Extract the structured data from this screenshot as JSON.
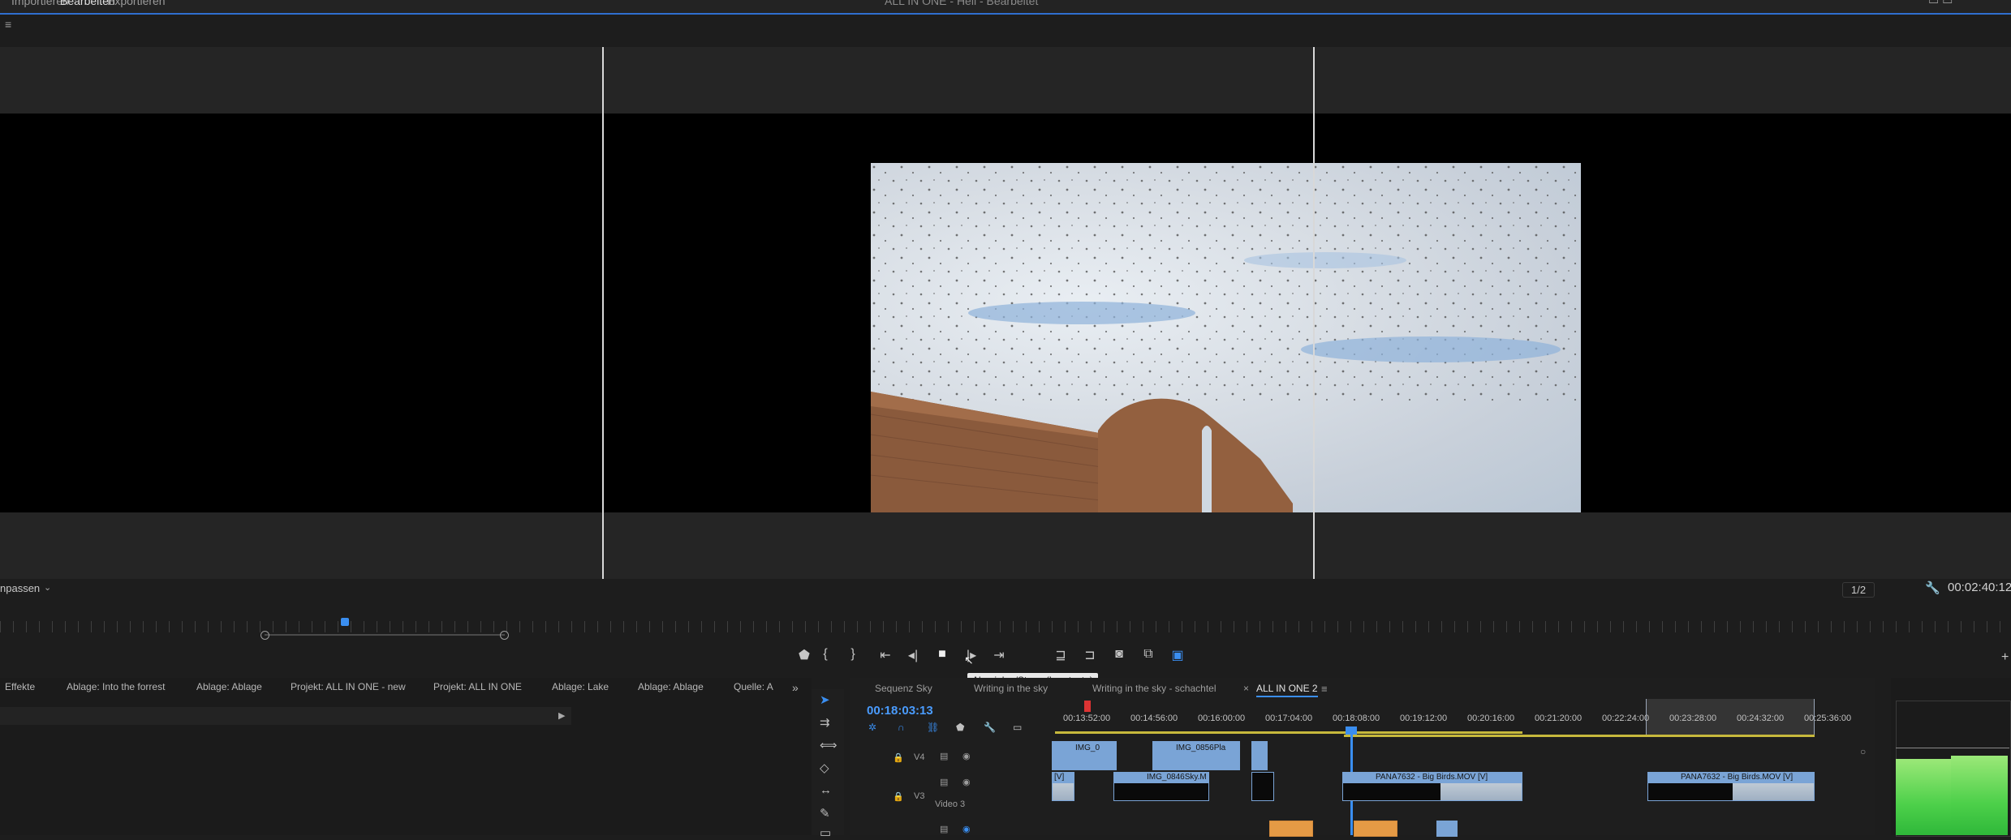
{
  "app": {
    "title": "ALL IN ONE - Hell - Bearbeitet",
    "workspaces": [
      "Importieren",
      "Bearbeiten",
      "Exportieren"
    ],
    "active_workspace": "Bearbeiten"
  },
  "program_monitor": {
    "fit_label": "npassen",
    "resolution": "1/2",
    "duration": "00:02:40:12",
    "tooltip": "Abspielen/Stopp (Leertaste)"
  },
  "transport_icons": [
    "marker-icon",
    "mark-in-icon",
    "mark-out-icon",
    "go-to-in-icon",
    "step-back-icon",
    "stop-icon",
    "step-forward-icon",
    "go-to-out-icon",
    "lift-icon",
    "extract-icon",
    "export-frame-icon",
    "comparison-view-icon",
    "vr-toggle-icon"
  ],
  "panel_tabs": [
    "Effekte",
    "Ablage: Into the forrest",
    "Ablage: Ablage",
    "Projekt: ALL IN ONE - new",
    "Projekt: ALL IN ONE",
    "Ablage: Lake",
    "Ablage: Ablage",
    "Quelle: A"
  ],
  "timeline": {
    "tabs": [
      "Sequenz Sky",
      "Writing in the sky",
      "Writing in the sky - schachtel",
      "ALL IN ONE 2"
    ],
    "active_tab": "ALL IN ONE 2",
    "current_time": "00:18:03:13",
    "ruler_labels": [
      "00:13:52:00",
      "00:14:56:00",
      "00:16:00:00",
      "00:17:04:00",
      "00:18:08:00",
      "00:19:12:00",
      "00:20:16:00",
      "00:21:20:00",
      "00:22:24:00",
      "00:23:28:00",
      "00:24:32:00",
      "00:25:36:00"
    ],
    "tracks": [
      {
        "id": "V4",
        "name": ""
      },
      {
        "id": "V3",
        "name": "Video 3"
      }
    ],
    "clips": {
      "v4_a": "IMG_0",
      "v4_b": "IMG_0856Pla",
      "v3_left": "[V]",
      "v3_a": "IMG_0846Sky.M",
      "v3_b": "PANA7632 - Big Birds.MOV [V]",
      "v3_c": "PANA7632 - Big Birds.MOV [V]"
    }
  },
  "colors": {
    "accent": "#3a8ef0",
    "clip_video": "#7aa4d6",
    "clip_audio": "#e59a45"
  }
}
